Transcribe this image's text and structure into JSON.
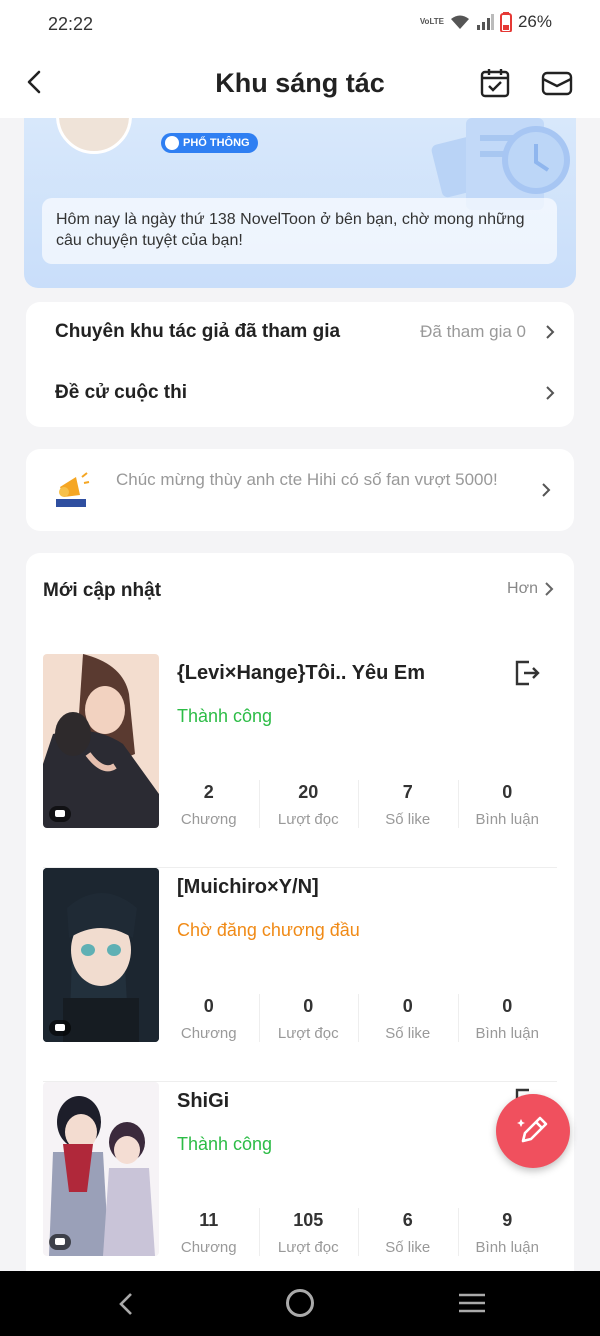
{
  "status_bar": {
    "time": "22:22",
    "network": "VoLTE",
    "battery": "26%"
  },
  "header": {
    "title": "Khu sáng tác"
  },
  "profile": {
    "level_badge": "PHỔ THÔNG",
    "message": "Hôm nay là ngày thứ 138 NovelToon ở bên bạn, chờ mong những câu chuyện tuyệt của bạn!"
  },
  "links": [
    {
      "label": "Chuyên khu tác giả đã tham gia",
      "value": "Đã tham gia 0"
    },
    {
      "label": "Đề cử cuộc thi",
      "value": ""
    }
  ],
  "notice": {
    "text": "Chúc mừng thùy anh cte Hihi có số fan vượt 5000!"
  },
  "updates": {
    "title": "Mới cập nhật",
    "more": "Hơn",
    "stories": [
      {
        "title": "{Levi×Hange}Tôi.. Yêu Em",
        "status": "Thành công",
        "status_color": "#2cbc46",
        "stats": [
          {
            "value": "2",
            "label": "Chương"
          },
          {
            "value": "20",
            "label": "Lượt đọc"
          },
          {
            "value": "7",
            "label": "Số like"
          },
          {
            "value": "0",
            "label": "Bình luận"
          }
        ]
      },
      {
        "title": "[Muichiro×Y/N]",
        "status": "Chờ đăng chương đầu",
        "status_color": "#f08a16",
        "stats": [
          {
            "value": "0",
            "label": "Chương"
          },
          {
            "value": "0",
            "label": "Lượt đọc"
          },
          {
            "value": "0",
            "label": "Số like"
          },
          {
            "value": "0",
            "label": "Bình luận"
          }
        ]
      },
      {
        "title": "ShiGi",
        "status": "Thành công",
        "status_color": "#2cbc46",
        "stats": [
          {
            "value": "11",
            "label": "Chương"
          },
          {
            "value": "105",
            "label": "Lượt đọc"
          },
          {
            "value": "6",
            "label": "Số like"
          },
          {
            "value": "9",
            "label": "Bình luận"
          }
        ]
      }
    ]
  },
  "colors": {
    "accent": "#f0505e",
    "success": "#2cbc46",
    "warning": "#f08a16",
    "badge": "#2f7ff2"
  },
  "icons": [
    "back-arrow-icon",
    "calendar-check-icon",
    "mail-icon",
    "chevron-right-icon",
    "megaphone-icon",
    "exit-icon",
    "pencil-icon"
  ]
}
